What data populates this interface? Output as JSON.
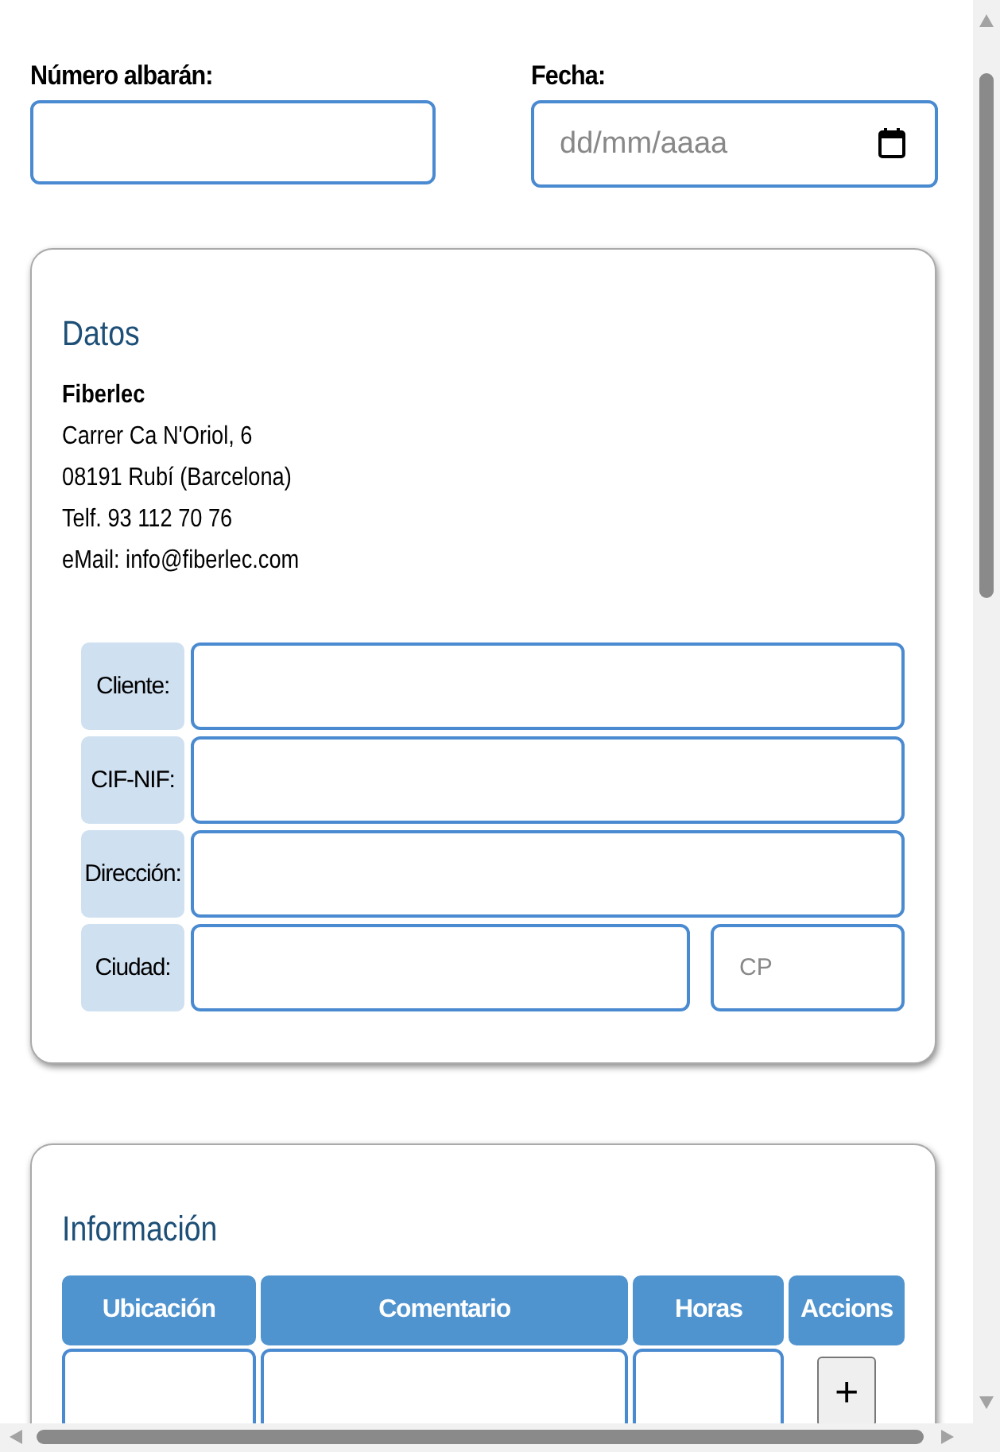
{
  "header_fields": [
    {
      "kind": "text",
      "label": "Número albarán:"
    },
    {
      "kind": "date",
      "label": "Fecha:",
      "placeholder": "dd/mm/aaaa"
    }
  ],
  "datos": {
    "title": "Datos",
    "company": {
      "name": "Fiberlec",
      "lines": [
        "Carrer Ca N'Oriol, 6",
        "08191 Rubí (Barcelona)",
        "Telf. 93 112 70 76",
        "eMail: info@fiberlec.com"
      ]
    },
    "rows": [
      {
        "label": "Cliente:"
      },
      {
        "label": "CIF-NIF:"
      },
      {
        "label": "Dirección:"
      },
      {
        "label": "Ciudad:",
        "extra_field": {
          "placeholder": "CP"
        }
      }
    ]
  },
  "informacion": {
    "title": "Información",
    "table": {
      "columns": [
        "Ubicación",
        "Comentario",
        "Horas",
        "Accions"
      ],
      "add_button": "+"
    }
  }
}
